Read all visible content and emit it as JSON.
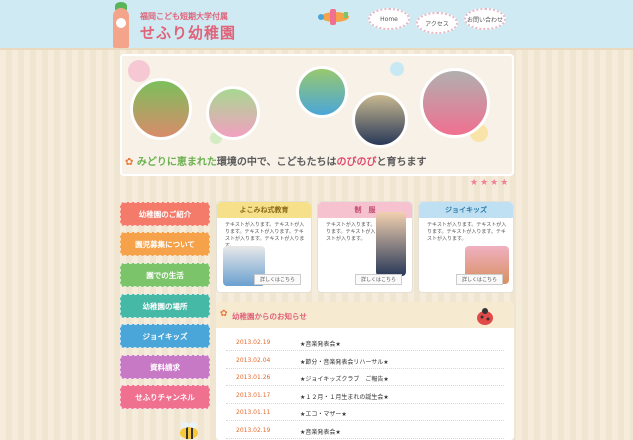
{
  "header": {
    "subtitle": "福岡こども短期大学付属",
    "title": "せふり幼稚園",
    "nav": [
      {
        "label": "Home"
      },
      {
        "label": "アクセス"
      },
      {
        "label": "お問い合わせ"
      }
    ]
  },
  "hero": {
    "tagline_parts": [
      "みどりに恵まれた",
      "環境の中で、こどもたちは",
      "のびのび",
      "と育ちます"
    ],
    "stars": "★★★★"
  },
  "sidebar": {
    "items": [
      {
        "label": "幼稚園のご紹介",
        "color": "#f47a6a"
      },
      {
        "label": "園児募集について",
        "color": "#f5a24a"
      },
      {
        "label": "園での生活",
        "color": "#7cc46a"
      },
      {
        "label": "幼稚園の場所",
        "color": "#46b8a6"
      },
      {
        "label": "ジョイキッズ",
        "color": "#4aa6d8"
      },
      {
        "label": "資料請求",
        "color": "#c879c6"
      },
      {
        "label": "せふりチャンネル",
        "color": "#f07090"
      }
    ]
  },
  "cards": [
    {
      "title": "よこみね式教育",
      "header_color": "#f6e08a",
      "text": "テキストが入ります。テキストが入ります。テキストが入ります。テキストが入ります。テキストが入ります。",
      "link": "詳しくはこちら"
    },
    {
      "title": "制　服",
      "header_color": "#f7c2d0",
      "text": "テキストが入ります。テキストが入ります。テキストが入ります。テキストが入ります。",
      "link": "詳しくはこちら"
    },
    {
      "title": "ジョイキッズ",
      "header_color": "#bfe0f2",
      "text": "テキストが入ります。テキストが入ります。テキストが入ります。テキストが入ります。",
      "link": "詳しくはこちら"
    }
  ],
  "news": {
    "title": "幼稚園からのお知らせ",
    "items": [
      {
        "date": "2013.02.19",
        "text": "★音楽発表会★"
      },
      {
        "date": "2013.02.04",
        "text": "★節分・音楽発表会リハーサル★"
      },
      {
        "date": "2013.01.26",
        "text": "★ジョイキッズクラブ　ご報告★"
      },
      {
        "date": "2013.01.17",
        "text": "★１２月・１月生まれの誕生会★"
      },
      {
        "date": "2013.01.11",
        "text": "★エコ・マザー★"
      },
      {
        "date": "2013.02.19",
        "text": "★音楽発表会★"
      }
    ]
  },
  "colors": {
    "accent": "#e0637a",
    "header_bg": "#cfeaf2",
    "date": "#e56a2d"
  }
}
